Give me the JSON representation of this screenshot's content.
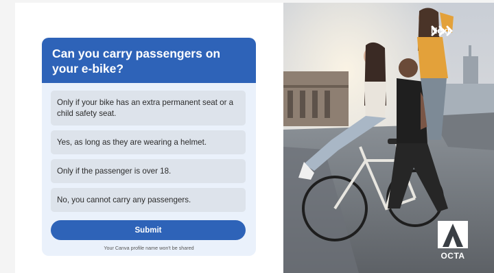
{
  "quiz": {
    "question": "Can you carry passengers on your e-bike?",
    "options": [
      "Only if your bike has an extra permanent seat or a child safety seat.",
      "Yes, as long as they are wearing a helmet.",
      "Only if the passenger is over 18.",
      "No, you cannot carry any passengers."
    ],
    "submit_label": "Submit",
    "privacy_note": "Your Canva profile name won't be shared"
  },
  "photo_panel": {
    "next_label": "Next",
    "next_icon": "triple-chevron-right-icon",
    "logo_text": "OCTA"
  },
  "colors": {
    "header_blue": "#2e63b8",
    "card_background": "#eaf1fb",
    "option_background": "#dde3eb",
    "submit_blue": "#2e63b8"
  }
}
